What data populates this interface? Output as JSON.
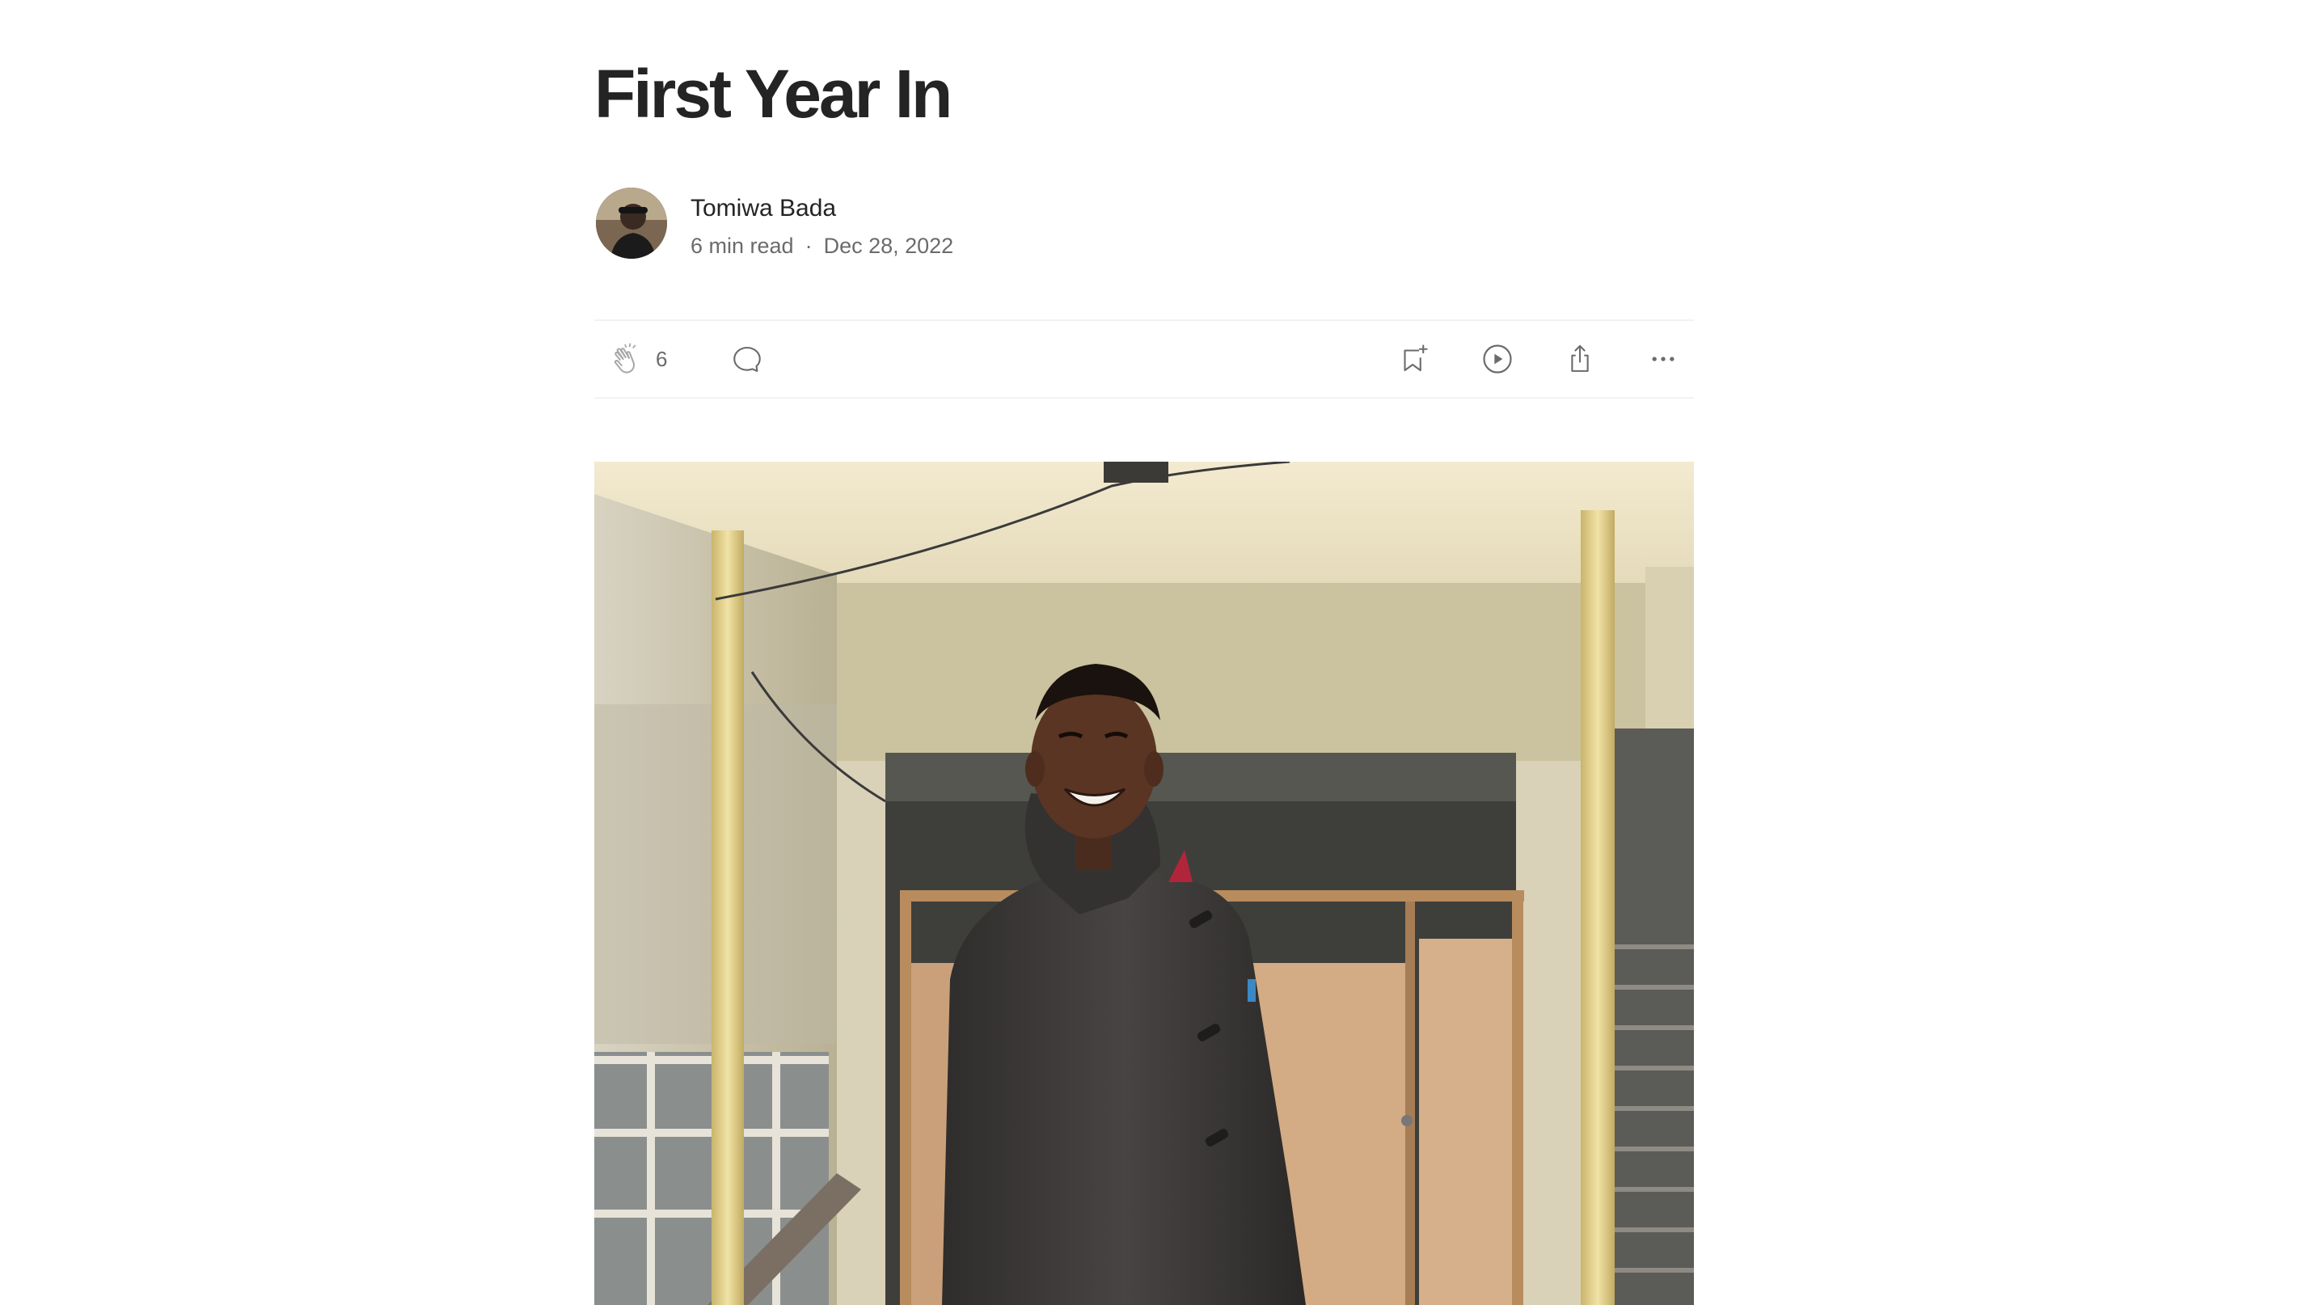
{
  "article": {
    "title": "First Year In",
    "author": "Tomiwa Bada",
    "read_time": "6 min read",
    "separator": "·",
    "date": "Dec 28, 2022"
  },
  "actions": {
    "clap_count": "6",
    "icons": [
      "clap-icon",
      "comment-icon",
      "bookmark-add-icon",
      "play-circle-icon",
      "share-icon",
      "more-horizontal-icon"
    ]
  },
  "hero_image": {
    "description_icon": "photo",
    "colors": {
      "ceiling": "#efe6c8",
      "wall": "#c9c09a",
      "jacket": "#3b3938",
      "door": "#cfa883",
      "pillar": "#e3d08c"
    }
  }
}
